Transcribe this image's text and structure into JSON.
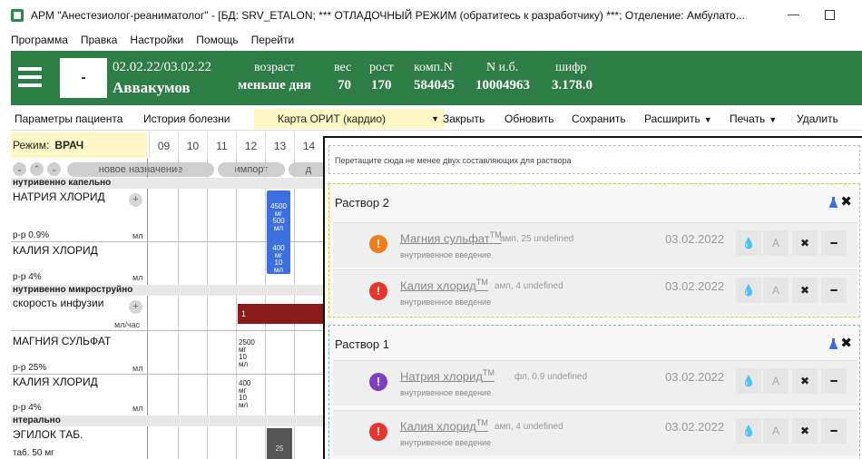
{
  "window": {
    "title": "АРМ \"Анестезиолог-реаниматолог\" - [БД: SRV_ETALON; *** ОТЛАДОЧНЫЙ РЕЖИМ (обратитесь к разработчику) ***; Отделение: Амбулато...",
    "minimize": "—"
  },
  "menu": [
    "Программа",
    "Правка",
    "Настройки",
    "Помощь",
    "Перейти"
  ],
  "header": {
    "minus": "-",
    "dates": "02.02.22/03.02.22",
    "name": "Аввакумов",
    "age_label": "возраст",
    "age_value": "меньше дня",
    "weight_label": "вес",
    "weight_value": "70",
    "height_label": "рост",
    "height_value": "170",
    "comp_label": "комп.N",
    "comp_value": "584045",
    "case_label": "N и.б.",
    "case_value": "10004963",
    "cipher_label": "шифр",
    "cipher_value": "3.178.0"
  },
  "toolbar": {
    "patient_params": "Параметры пациента",
    "history": "История болезни",
    "card": "Карта ОРИТ (кардио)",
    "close": "Закрыть",
    "refresh": "Обновить",
    "save": "Сохранить",
    "expand": "Расширить",
    "print": "Печать",
    "delete": "Удалить"
  },
  "grid": {
    "mode_label": "Режим:",
    "mode_value": "ВРАЧ",
    "hours": [
      "09",
      "10",
      "11",
      "12",
      "13",
      "14"
    ],
    "new_assignment": "новое назначение",
    "import": "импорт",
    "cut_label": "д",
    "groups": [
      "нутривенно капельно",
      "нутривенно микроструйно",
      "нтерально"
    ],
    "drugs": [
      {
        "name": "НАТРИЯ ХЛОРИД",
        "conc": "р-р 0.9%",
        "unit": "мл"
      },
      {
        "name": "КАЛИЯ ХЛОРИД",
        "conc": "р-р 4%",
        "unit": "мл"
      },
      {
        "name": "скорость инфузии",
        "conc": "",
        "unit": "мл/час"
      },
      {
        "name": "МАГНИЯ СУЛЬФАТ",
        "conc": "р-р 25%",
        "unit": "мл"
      },
      {
        "name": "КАЛИЯ ХЛОРИД",
        "conc": "р-р 4%",
        "unit": "мл"
      },
      {
        "name": "ЭГИЛОК ТАБ.",
        "conc": "таб. 50 мг",
        "unit": ""
      }
    ],
    "blue_bar_lines": [
      "4500",
      "мг",
      "500",
      "мл",
      "",
      "400",
      "мг",
      "10",
      "мл"
    ],
    "red_bar_value": "1",
    "mg_lines": [
      "2500",
      "мг",
      "10",
      "мл"
    ],
    "k_lines": [
      "400",
      "мг",
      "10",
      "мл"
    ],
    "gray_value": "25"
  },
  "panel": {
    "drop_hint": "Перетащите сюда не менее двух составляющих для раствора",
    "solutions": [
      {
        "title": "Раствор 2",
        "items": [
          {
            "badge": "!",
            "badge_color": "#f07c1a",
            "name": "Магния сульфат",
            "tm": "TM",
            "detail": "амп, 25 undefined",
            "route": "внутривенное введение",
            "date": "03.02.2022"
          },
          {
            "badge": "!",
            "badge_color": "#e8342a",
            "name": "Калия хлорид",
            "tm": "TM",
            "detail": "амп, 4 undefined",
            "route": "внутривенное введение",
            "date": "03.02.2022"
          }
        ]
      },
      {
        "title": "Раствор 1",
        "items": [
          {
            "badge": "!",
            "badge_color": "#7b3fc4",
            "name": "Натрия хлорид",
            "tm": "TM",
            "detail": "фл, 0.9 undefined",
            "route": "внутривенное введение",
            "date": "03.02.2022"
          },
          {
            "badge": "!",
            "badge_color": "#e8342a",
            "name": "Калия хлорид",
            "tm": "TM",
            "detail": "амп, 4 undefined",
            "route": "внутривенное введение",
            "date": "03.02.2022"
          }
        ]
      }
    ],
    "btn_drop": "💧",
    "btn_a": "A",
    "btn_x": "✖",
    "btn_minus": "━",
    "close_icon": "✖"
  }
}
